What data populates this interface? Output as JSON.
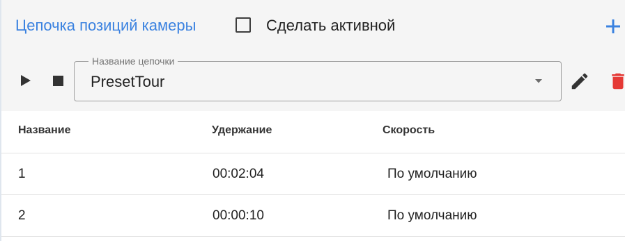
{
  "header": {
    "title": "Цепочка позиций камеры",
    "make_active_label": "Сделать активной"
  },
  "toolbar": {
    "select_legend": "Название цепочки",
    "select_value": "PresetTour"
  },
  "table": {
    "columns": [
      "Название",
      "Удержание",
      "Скорость"
    ],
    "rows": [
      {
        "name": "1",
        "hold": "00:02:04",
        "speed": "По умолчанию"
      },
      {
        "name": "2",
        "hold": "00:00:10",
        "speed": "По умолчанию"
      }
    ]
  },
  "colors": {
    "accent": "#3b82e0",
    "delete": "#e53935",
    "header_bg": "#f5f5f5"
  },
  "icons": {
    "add": "plus-icon",
    "play": "play-icon",
    "stop": "stop-icon",
    "dropdown": "caret-down-icon",
    "edit": "pencil-icon",
    "delete": "trash-icon"
  }
}
